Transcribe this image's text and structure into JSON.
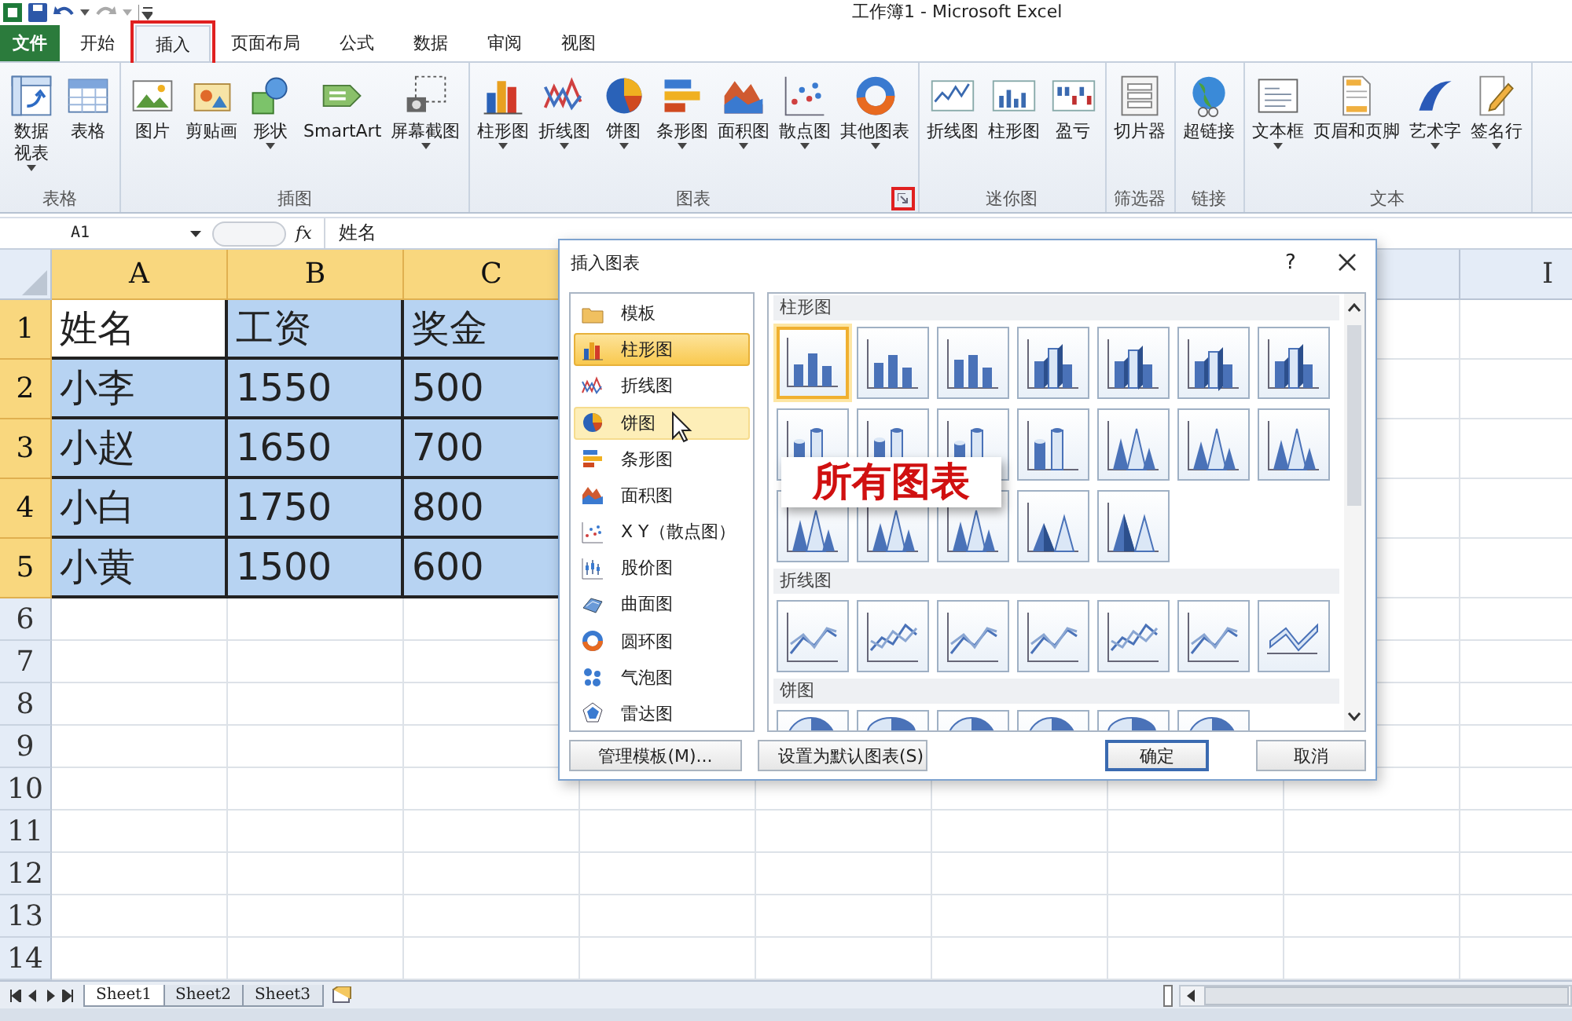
{
  "title_bar": {
    "title": "工作簿1  -  Microsoft Excel"
  },
  "ribbon_tabs": [
    {
      "label": "文件",
      "kind": "file",
      "selected": false,
      "annotated": false
    },
    {
      "label": "开始",
      "kind": "tab",
      "selected": false,
      "annotated": false
    },
    {
      "label": "插入",
      "kind": "tab",
      "selected": true,
      "annotated": true
    },
    {
      "label": "页面布局",
      "kind": "tab",
      "selected": false,
      "annotated": false
    },
    {
      "label": "公式",
      "kind": "tab",
      "selected": false,
      "annotated": false
    },
    {
      "label": "数据",
      "kind": "tab",
      "selected": false,
      "annotated": false
    },
    {
      "label": "审阅",
      "kind": "tab",
      "selected": false,
      "annotated": false
    },
    {
      "label": "视图",
      "kind": "tab",
      "selected": false,
      "annotated": false
    }
  ],
  "ribbon_groups": [
    {
      "label": "表格",
      "buttons": [
        {
          "lines": [
            "数据",
            "视表"
          ],
          "dropdown": true
        },
        {
          "lines": [
            "表格"
          ],
          "dropdown": false
        }
      ]
    },
    {
      "label": "插图",
      "buttons": [
        {
          "lines": [
            "图片"
          ],
          "dropdown": false
        },
        {
          "lines": [
            "剪贴画"
          ],
          "dropdown": false
        },
        {
          "lines": [
            "形状"
          ],
          "dropdown": true
        },
        {
          "lines": [
            "SmartArt"
          ],
          "dropdown": false
        },
        {
          "lines": [
            "屏幕截图"
          ],
          "dropdown": true
        }
      ]
    },
    {
      "label": "图表",
      "launcher": {
        "annotated": true
      },
      "buttons": [
        {
          "lines": [
            "柱形图"
          ],
          "dropdown": true
        },
        {
          "lines": [
            "折线图"
          ],
          "dropdown": true
        },
        {
          "lines": [
            "饼图"
          ],
          "dropdown": true
        },
        {
          "lines": [
            "条形图"
          ],
          "dropdown": true
        },
        {
          "lines": [
            "面积图"
          ],
          "dropdown": true
        },
        {
          "lines": [
            "散点图"
          ],
          "dropdown": true
        },
        {
          "lines": [
            "其他图表"
          ],
          "dropdown": true
        }
      ]
    },
    {
      "label": "迷你图",
      "buttons": [
        {
          "lines": [
            "折线图"
          ],
          "dropdown": false
        },
        {
          "lines": [
            "柱形图"
          ],
          "dropdown": false
        },
        {
          "lines": [
            "盈亏"
          ],
          "dropdown": false
        }
      ]
    },
    {
      "label": "筛选器",
      "buttons": [
        {
          "lines": [
            "切片器"
          ],
          "dropdown": false
        }
      ]
    },
    {
      "label": "链接",
      "buttons": [
        {
          "lines": [
            "超链接"
          ],
          "dropdown": false
        }
      ]
    },
    {
      "label": "文本",
      "buttons": [
        {
          "lines": [
            "文本框"
          ],
          "dropdown": true
        },
        {
          "lines": [
            "页眉和页脚"
          ],
          "dropdown": false
        },
        {
          "lines": [
            "艺术字"
          ],
          "dropdown": true
        },
        {
          "lines": [
            "签名行"
          ],
          "dropdown": true
        }
      ]
    }
  ],
  "formula_bar": {
    "name_box": "A1",
    "fx": "fx",
    "value": "姓名"
  },
  "sheet": {
    "columns": [
      {
        "letter": "A",
        "selected": true
      },
      {
        "letter": "B",
        "selected": true
      },
      {
        "letter": "C",
        "selected": true
      },
      {
        "letter": "I",
        "selected": false
      }
    ],
    "rows": [
      {
        "number": "1",
        "selected": true,
        "cells": [
          {
            "text": "姓名",
            "active": true
          },
          {
            "text": "工资",
            "active": false
          },
          {
            "text": "奖金",
            "active": false
          }
        ]
      },
      {
        "number": "2",
        "selected": true,
        "cells": [
          {
            "text": "小李",
            "active": false
          },
          {
            "text": "1550",
            "active": false
          },
          {
            "text": "500",
            "active": false
          }
        ]
      },
      {
        "number": "3",
        "selected": true,
        "cells": [
          {
            "text": "小赵",
            "active": false
          },
          {
            "text": "1650",
            "active": false
          },
          {
            "text": "700",
            "active": false
          }
        ]
      },
      {
        "number": "4",
        "selected": true,
        "cells": [
          {
            "text": "小白",
            "active": false
          },
          {
            "text": "1750",
            "active": false
          },
          {
            "text": "800",
            "active": false
          }
        ]
      },
      {
        "number": "5",
        "selected": true,
        "cells": [
          {
            "text": "小黄",
            "active": false
          },
          {
            "text": "1500",
            "active": false
          },
          {
            "text": "600",
            "active": false
          }
        ]
      },
      {
        "number": "6",
        "selected": false
      },
      {
        "number": "7",
        "selected": false
      },
      {
        "number": "8",
        "selected": false
      },
      {
        "number": "9",
        "selected": false
      },
      {
        "number": "10",
        "selected": false
      },
      {
        "number": "11",
        "selected": false
      },
      {
        "number": "12",
        "selected": false
      },
      {
        "number": "13",
        "selected": false
      },
      {
        "number": "14",
        "selected": false
      }
    ]
  },
  "sheet_tabs": [
    {
      "label": "Sheet1",
      "selected": true
    },
    {
      "label": "Sheet2",
      "selected": false
    },
    {
      "label": "Sheet3",
      "selected": false
    }
  ],
  "dialog": {
    "title": "插入图表",
    "help": "?",
    "categories": [
      {
        "label": "模板",
        "selected": false,
        "hovered": false
      },
      {
        "label": "柱形图",
        "selected": true,
        "hovered": false
      },
      {
        "label": "折线图",
        "selected": false,
        "hovered": false
      },
      {
        "label": "饼图",
        "selected": false,
        "hovered": true
      },
      {
        "label": "条形图",
        "selected": false,
        "hovered": false
      },
      {
        "label": "面积图",
        "selected": false,
        "hovered": false
      },
      {
        "label": "X Y（散点图）",
        "selected": false,
        "hovered": false
      },
      {
        "label": "股价图",
        "selected": false,
        "hovered": false
      },
      {
        "label": "曲面图",
        "selected": false,
        "hovered": false
      },
      {
        "label": "圆环图",
        "selected": false,
        "hovered": false
      },
      {
        "label": "气泡图",
        "selected": false,
        "hovered": false
      },
      {
        "label": "雷达图",
        "selected": false,
        "hovered": false
      }
    ],
    "sections": [
      {
        "heading": "柱形图",
        "thumbnails": [
          {
            "kind": "column",
            "selected": true
          },
          {
            "kind": "column",
            "selected": false
          },
          {
            "kind": "column",
            "selected": false
          },
          {
            "kind": "column3d",
            "selected": false
          },
          {
            "kind": "column3d",
            "selected": false
          },
          {
            "kind": "column3d",
            "selected": false
          },
          {
            "kind": "column3d",
            "selected": false
          },
          {
            "kind": "cylinder",
            "selected": false
          },
          {
            "kind": "cylinder",
            "selected": false
          },
          {
            "kind": "cylinder",
            "selected": false
          },
          {
            "kind": "cylinder",
            "selected": false
          },
          {
            "kind": "cone",
            "selected": false
          },
          {
            "kind": "cone",
            "selected": false
          },
          {
            "kind": "cone",
            "selected": false
          },
          {
            "kind": "cone",
            "selected": false
          },
          {
            "kind": "cone",
            "selected": false
          },
          {
            "kind": "cone",
            "selected": false
          },
          {
            "kind": "pyramid",
            "selected": false
          },
          {
            "kind": "pyramid",
            "selected": false
          }
        ]
      },
      {
        "heading": "折线图",
        "thumbnails": [
          {
            "kind": "line",
            "selected": false
          },
          {
            "kind": "line",
            "selected": false
          },
          {
            "kind": "line",
            "selected": false
          },
          {
            "kind": "line",
            "selected": false
          },
          {
            "kind": "line",
            "selected": false
          },
          {
            "kind": "line",
            "selected": false
          },
          {
            "kind": "line3d",
            "selected": false
          }
        ]
      },
      {
        "heading": "饼图",
        "thumbnails": [
          {
            "kind": "pie",
            "selected": false
          },
          {
            "kind": "pie",
            "selected": false
          },
          {
            "kind": "pie",
            "selected": false
          },
          {
            "kind": "pie",
            "selected": false
          },
          {
            "kind": "pie",
            "selected": false
          },
          {
            "kind": "pie",
            "selected": false
          }
        ]
      }
    ],
    "footer_buttons": [
      {
        "label": "管理模板(M)...",
        "kind": "left"
      },
      {
        "label": "设置为默认图表(S)",
        "kind": "left"
      },
      {
        "label": "确定",
        "kind": "default"
      },
      {
        "label": "取消",
        "kind": "normal"
      }
    ]
  },
  "callout": {
    "text": "所有图表"
  }
}
